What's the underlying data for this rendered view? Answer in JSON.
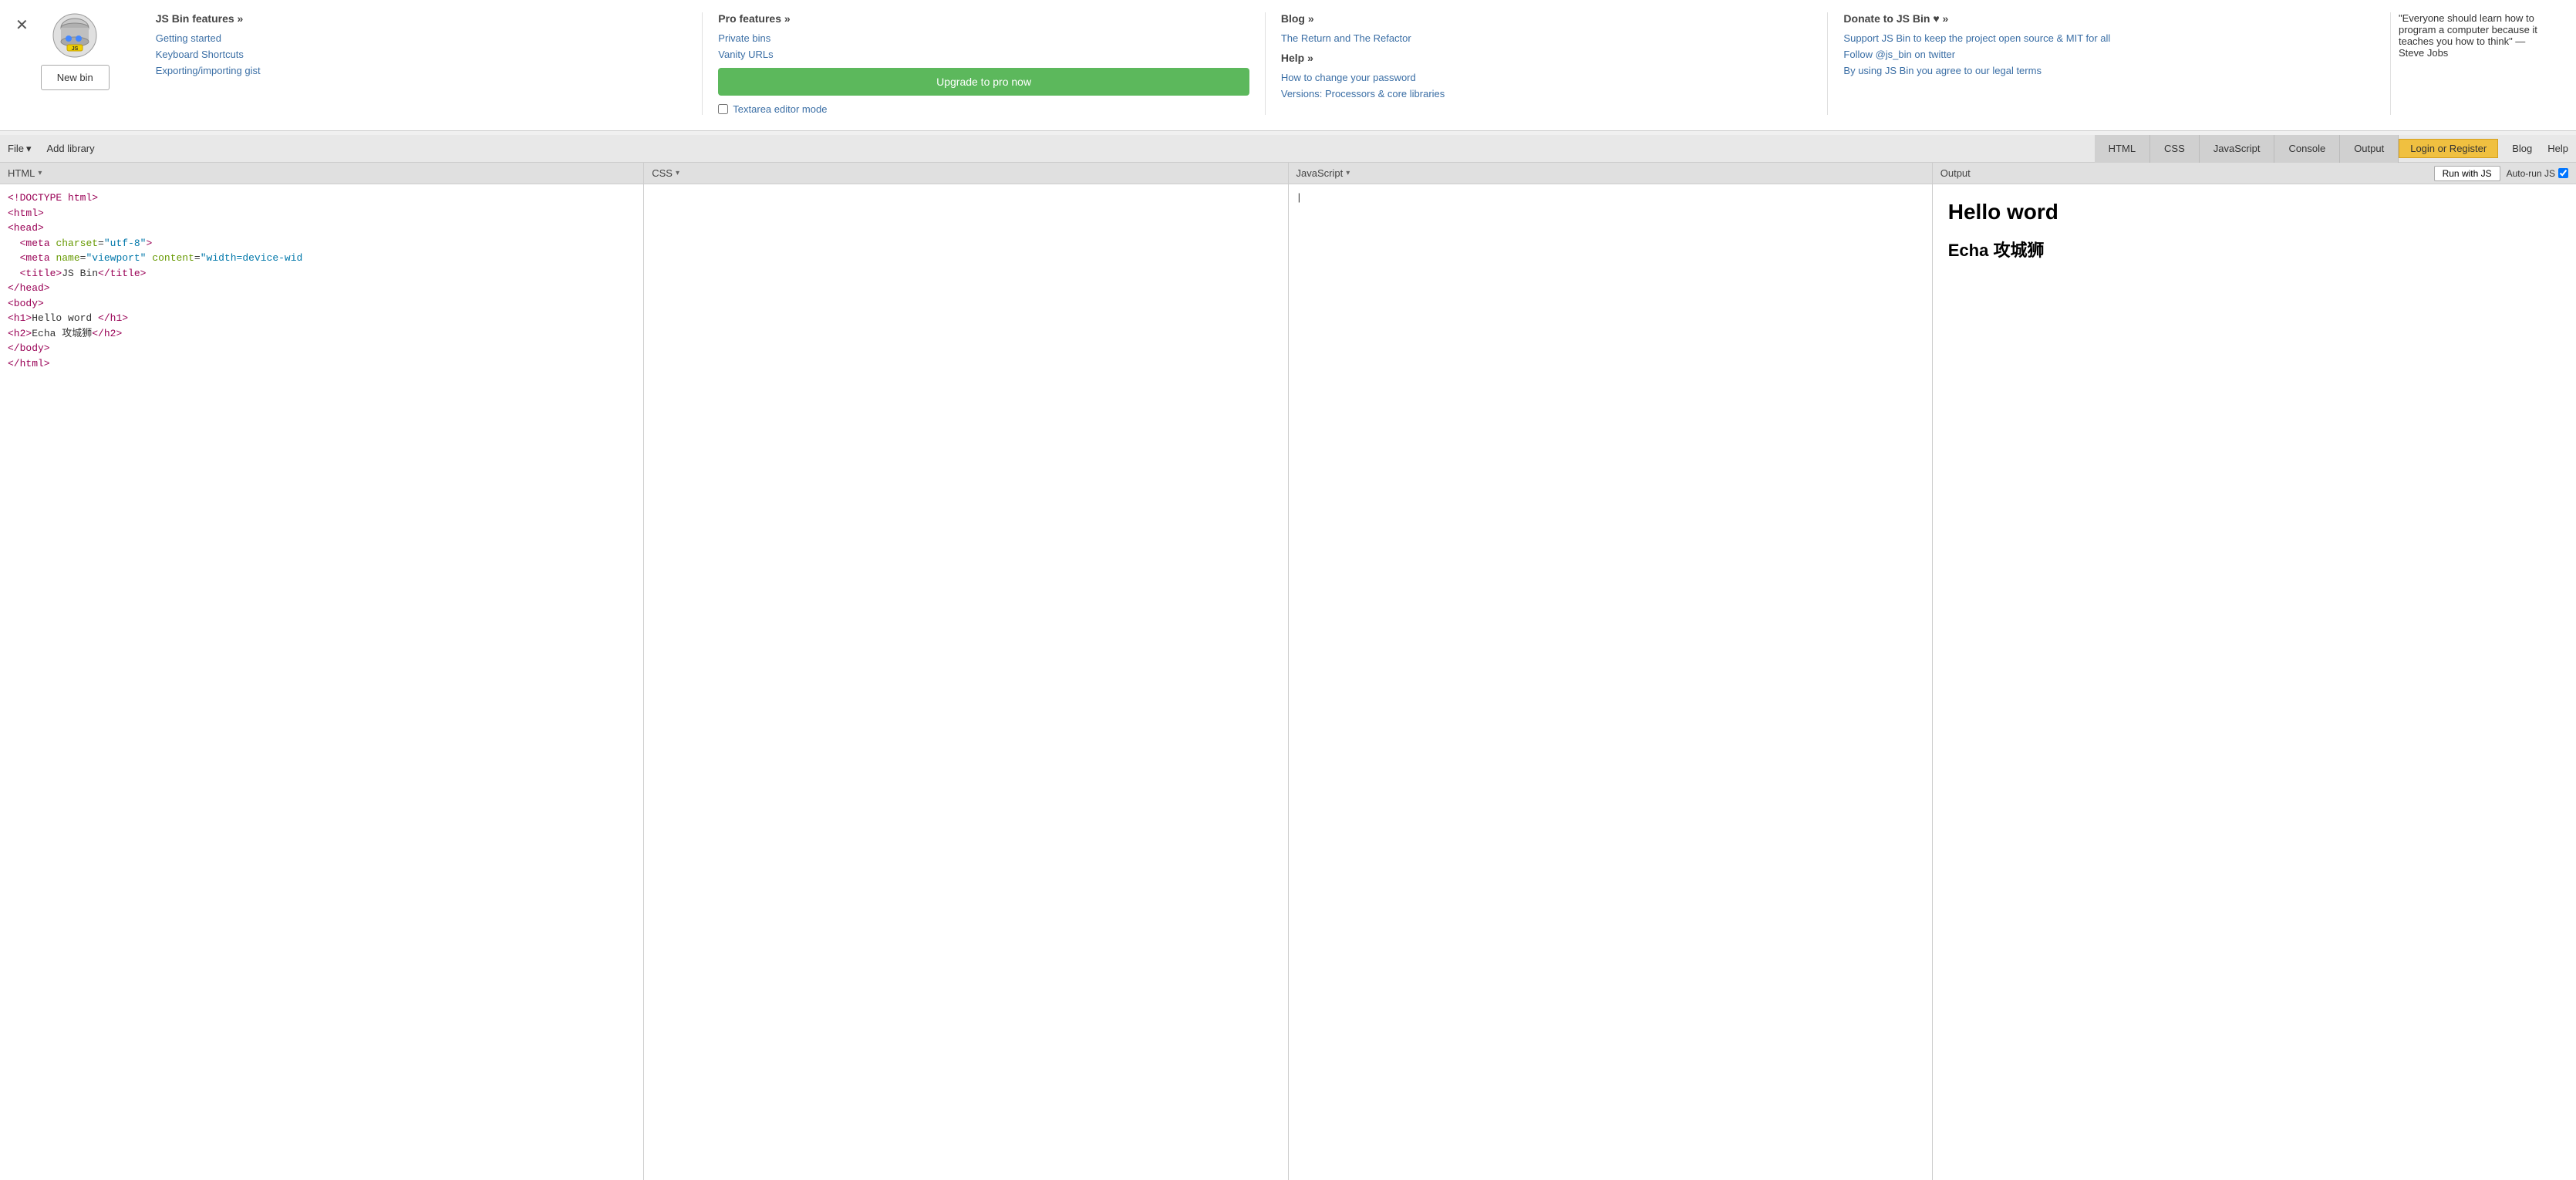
{
  "dropdown": {
    "close_label": "✕",
    "logo_alt": "JS Bin logo",
    "new_bin_label": "New bin",
    "columns": [
      {
        "title": "JS Bin features »",
        "links": [
          "Getting started",
          "Keyboard Shortcuts",
          "Exporting/importing gist"
        ],
        "extra": null
      },
      {
        "title": "Pro features »",
        "links": [
          "Private bins",
          "Vanity URLs"
        ],
        "upgrade_label": "Upgrade to pro now",
        "textarea_label": "Textarea editor mode"
      },
      {
        "title": "Blog »",
        "links": [
          "The Return and The Refactor"
        ],
        "help_title": "Help »",
        "help_links": [
          "How to change your password",
          "Versions: Processors & core libraries"
        ]
      },
      {
        "title": "Donate to JS Bin ♥ »",
        "links": [
          "Support JS Bin to keep the project open source & MIT for all",
          "Follow @js_bin on twitter",
          "By using JS Bin you agree to our legal terms"
        ]
      }
    ],
    "quote": "\"Everyone should learn how to program a computer because it teaches you how to think\" — Steve Jobs"
  },
  "toolbar": {
    "file_label": "File",
    "add_library_label": "Add library",
    "tabs": [
      "HTML",
      "CSS",
      "JavaScript",
      "Console",
      "Output"
    ],
    "login_label": "Login or Register",
    "blog_label": "Blog",
    "help_label": "Help"
  },
  "panels": {
    "html": {
      "header": "HTML",
      "code_lines": [
        "<!DOCTYPE html>",
        "<html>",
        "<head>",
        "  <meta charset=\"utf-8\">",
        "  <meta name=\"viewport\" content=\"width=device-wid",
        "  <title>JS Bin</title>",
        "</head>",
        "<body>",
        "<h1>Hello word </h1>",
        "<h2>Echa 攻城狮</h2>",
        "</body>",
        "</html>"
      ]
    },
    "css": {
      "header": "CSS"
    },
    "javascript": {
      "header": "JavaScript"
    },
    "output": {
      "header": "Output",
      "run_js_label": "Run with JS",
      "auto_run_label": "Auto-run JS",
      "h1_content": "Hello word",
      "h2_content": "Echa 攻城狮"
    }
  }
}
